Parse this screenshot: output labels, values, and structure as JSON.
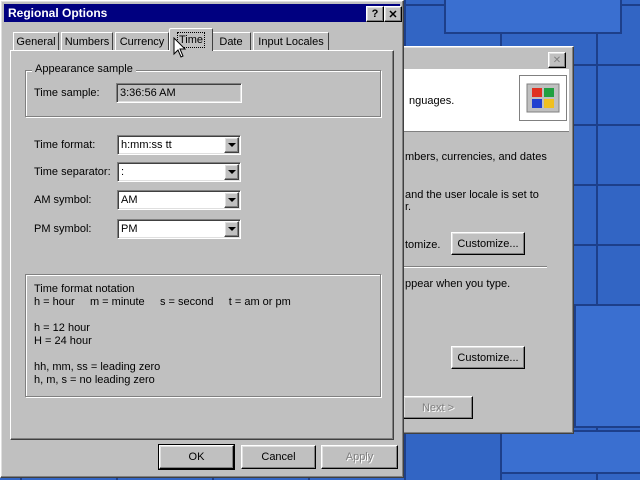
{
  "dialog": {
    "title": "Regional Options",
    "help_glyph": "?",
    "close_glyph": "✕",
    "tabs": [
      {
        "label": "General"
      },
      {
        "label": "Numbers"
      },
      {
        "label": "Currency"
      },
      {
        "label": "Time"
      },
      {
        "label": "Date"
      },
      {
        "label": "Input Locales"
      }
    ],
    "active_tab": "Time",
    "appearance": {
      "legend": "Appearance sample",
      "time_sample_label": "Time sample:",
      "time_sample_value": "3:36:56 AM"
    },
    "fields": [
      {
        "label": "Time format:",
        "value": "h:mm:ss tt"
      },
      {
        "label": "Time separator:",
        "value": ":"
      },
      {
        "label": "AM symbol:",
        "value": "AM"
      },
      {
        "label": "PM symbol:",
        "value": "PM"
      }
    ],
    "notation": {
      "heading": "Time format notation",
      "line1": "h = hour     m = minute     s = second     t = am or pm",
      "line2": "h = 12 hour",
      "line3": "H = 24 hour",
      "line4": "hh, mm, ss = leading zero",
      "line5": "h, m, s = no leading zero"
    },
    "buttons": {
      "ok": "OK",
      "cancel": "Cancel",
      "apply": "Apply"
    }
  },
  "back_window": {
    "close_glyph": "✕",
    "text1": "nguages.",
    "text2": "mbers, currencies, and dates",
    "text3": "and the user locale is set to",
    "text3b": "r.",
    "text4": "tomize.",
    "customize1": "Customize...",
    "text5": "ppear when you type.",
    "customize2": "Customize...",
    "next": "Next >"
  }
}
